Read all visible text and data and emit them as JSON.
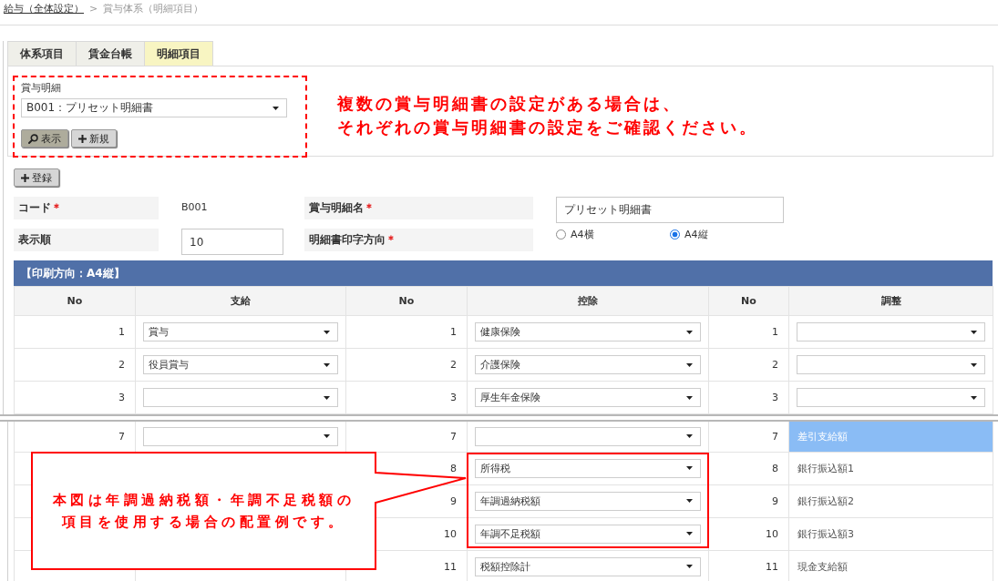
{
  "breadcrumb": {
    "items": [
      {
        "label": "給与（全体設定）",
        "kind": "link"
      },
      {
        "label": "賞与体系（明細項目）",
        "kind": "current"
      }
    ],
    "separator": ">"
  },
  "tabs": [
    {
      "label": "体系項目",
      "selected": false
    },
    {
      "label": "賃金台帳",
      "selected": false
    },
    {
      "label": "明細項目",
      "selected": true
    }
  ],
  "selector": {
    "label": "賞与明細",
    "value": "B001：プリセット明細書",
    "buttons": [
      {
        "label": "表示",
        "kind": "search"
      },
      {
        "label": "新規",
        "kind": "add"
      }
    ]
  },
  "notice": {
    "lines": [
      "複数の賞与明細書の設定がある場合は、",
      "それぞれの賞与明細書の設定をご確認ください。"
    ]
  },
  "register_button": {
    "label": "登録",
    "kind": "add"
  },
  "form": {
    "required_mark": "＊",
    "fields": [
      {
        "label": "コード",
        "required": true,
        "kind": "static",
        "value": "B001"
      },
      {
        "label": "賞与明細名",
        "required": true,
        "kind": "input",
        "value": "プリセット明細書"
      },
      {
        "label": "表示順",
        "kind": "input",
        "value": "10"
      },
      {
        "label": "明細書印字方向",
        "required": true,
        "kind": "radio",
        "options": [
          {
            "label": "A4横",
            "selected": false
          },
          {
            "label": "A4縦",
            "selected": true
          }
        ]
      }
    ]
  },
  "layout_table": {
    "title": "【印刷方向：A4縦】",
    "columns": [
      "No",
      "支給",
      "No",
      "控除",
      "No",
      "調整"
    ],
    "sections": [
      {
        "rows": [
          {
            "cells": [
              {
                "kind": "number",
                "text": "1"
              },
              {
                "kind": "select",
                "value": "賞与"
              },
              {
                "kind": "number",
                "text": "1"
              },
              {
                "kind": "select",
                "value": "健康保険"
              },
              {
                "kind": "number",
                "text": "1"
              },
              {
                "kind": "select"
              }
            ]
          },
          {
            "cells": [
              {
                "kind": "number",
                "text": "2"
              },
              {
                "kind": "select",
                "value": "役員賞与"
              },
              {
                "kind": "number",
                "text": "2"
              },
              {
                "kind": "select",
                "value": "介護保険"
              },
              {
                "kind": "number",
                "text": "2"
              },
              {
                "kind": "select"
              }
            ]
          },
          {
            "cells": [
              {
                "kind": "number",
                "text": "3"
              },
              {
                "kind": "select"
              },
              {
                "kind": "number",
                "text": "3"
              },
              {
                "kind": "select",
                "value": "厚生年金保険"
              },
              {
                "kind": "number",
                "text": "3"
              },
              {
                "kind": "select"
              }
            ]
          }
        ]
      },
      {
        "rows": [
          {
            "cells": [
              {
                "kind": "number",
                "text": "7"
              },
              {
                "kind": "select"
              },
              {
                "kind": "number",
                "text": "7"
              },
              {
                "kind": "select"
              },
              {
                "kind": "number",
                "text": "7"
              },
              {
                "kind": "text",
                "text": "差引支給額",
                "selected": true
              }
            ]
          },
          {
            "cells": [
              {
                "kind": "blank"
              },
              {
                "kind": "blank"
              },
              {
                "kind": "number",
                "text": "8"
              },
              {
                "kind": "select",
                "value": "所得税"
              },
              {
                "kind": "number",
                "text": "8"
              },
              {
                "kind": "text",
                "text": "銀行振込額1",
                "selected": false
              }
            ]
          },
          {
            "cells": [
              {
                "kind": "blank"
              },
              {
                "kind": "blank"
              },
              {
                "kind": "number",
                "text": "9"
              },
              {
                "kind": "select",
                "value": "年調過納税額"
              },
              {
                "kind": "number",
                "text": "9"
              },
              {
                "kind": "text",
                "text": "銀行振込額2",
                "selected": false
              }
            ]
          },
          {
            "cells": [
              {
                "kind": "blank"
              },
              {
                "kind": "blank"
              },
              {
                "kind": "number",
                "text": "10"
              },
              {
                "kind": "select",
                "value": "年調不足税額"
              },
              {
                "kind": "number",
                "text": "10"
              },
              {
                "kind": "text",
                "text": "銀行振込額3",
                "selected": false
              }
            ]
          },
          {
            "cells": [
              {
                "kind": "blank"
              },
              {
                "kind": "blank"
              },
              {
                "kind": "number",
                "text": "11"
              },
              {
                "kind": "select",
                "value": "税額控除計"
              },
              {
                "kind": "number",
                "text": "11"
              },
              {
                "kind": "text",
                "text": "現金支給額",
                "selected": false
              }
            ]
          }
        ]
      }
    ]
  },
  "callout": {
    "lines": [
      "本図は年調過納税額・年調不足税額の",
      "項目を使用する場合の配置例です。"
    ]
  }
}
